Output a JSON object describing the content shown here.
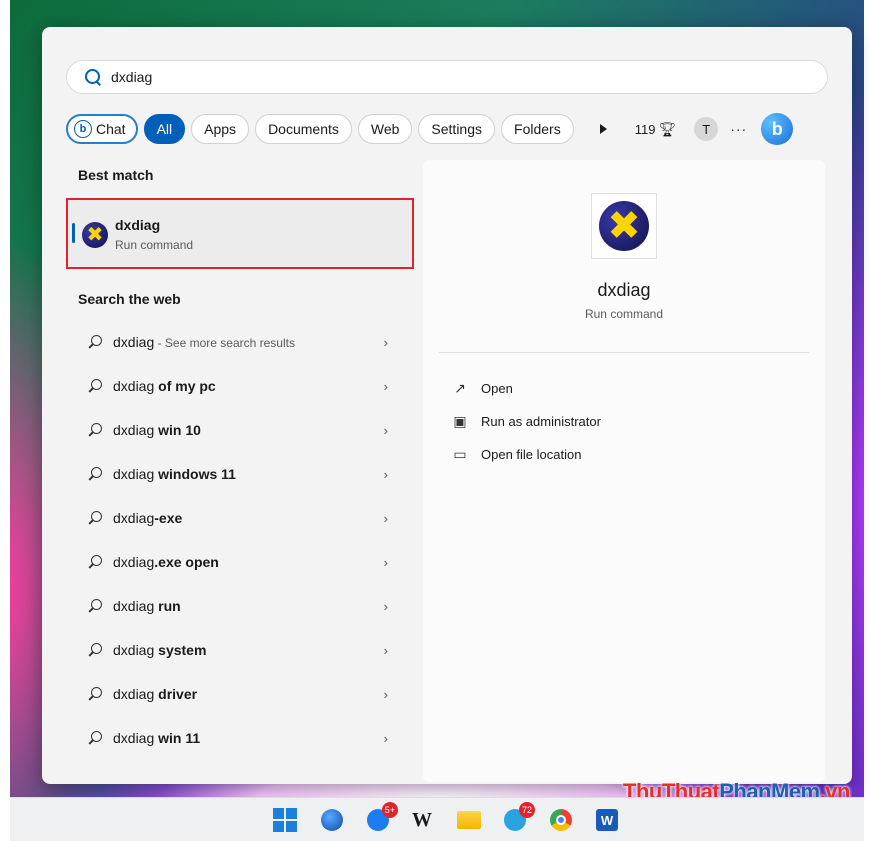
{
  "search": {
    "value": "dxdiag"
  },
  "filters": {
    "chat": "Chat",
    "all": "All",
    "apps": "Apps",
    "documents": "Documents",
    "web": "Web",
    "settings": "Settings",
    "folders": "Folders",
    "points": "119",
    "avatar_initial": "T",
    "more": "···"
  },
  "best_match": {
    "heading": "Best match",
    "name": "dxdiag",
    "subtitle": "Run command"
  },
  "web": {
    "heading": "Search the web",
    "items": [
      {
        "query": "dxdiag",
        "suffix": "",
        "muted": " - See more search results"
      },
      {
        "query": "dxdiag ",
        "suffix": "of my pc",
        "muted": ""
      },
      {
        "query": "dxdiag ",
        "suffix": "win 10",
        "muted": ""
      },
      {
        "query": "dxdiag ",
        "suffix": "windows 11",
        "muted": ""
      },
      {
        "query": "dxdiag",
        "suffix": "-exe",
        "muted": ""
      },
      {
        "query": "dxdiag",
        "suffix": ".exe open",
        "muted": ""
      },
      {
        "query": "dxdiag ",
        "suffix": "run",
        "muted": ""
      },
      {
        "query": "dxdiag ",
        "suffix": "system",
        "muted": ""
      },
      {
        "query": "dxdiag ",
        "suffix": "driver",
        "muted": ""
      },
      {
        "query": "dxdiag ",
        "suffix": "win 11",
        "muted": ""
      }
    ]
  },
  "detail": {
    "name": "dxdiag",
    "subtitle": "Run command",
    "actions": [
      "Open",
      "Run as administrator",
      "Open file location"
    ]
  },
  "taskbar": {
    "zalo_badge": "5+",
    "telegram_badge": "72"
  },
  "watermark": {
    "part1": "ThuThuat",
    "part2": "PhanMem",
    "part3": ".vn"
  },
  "colors": {
    "accent": "#005fb8",
    "highlight_border": "#e0242c"
  }
}
